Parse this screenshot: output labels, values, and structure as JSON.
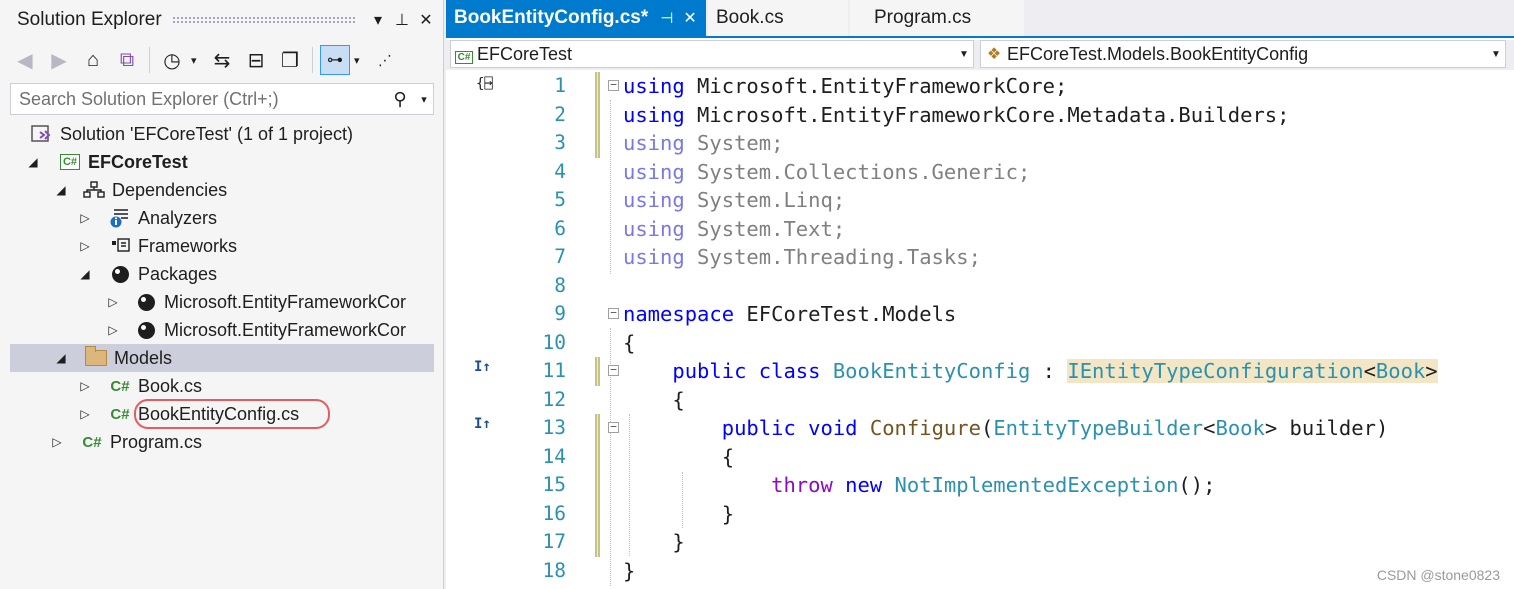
{
  "solution_explorer": {
    "title": "Solution Explorer",
    "search_placeholder": "Search Solution Explorer (Ctrl+;)",
    "tree": [
      {
        "label": "Solution 'EFCoreTest' (1 of 1 project)",
        "icon": "solution-icon"
      },
      {
        "label": "EFCoreTest",
        "icon": "csharp-project-icon",
        "expanded": true
      },
      {
        "label": "Dependencies",
        "icon": "dependencies-icon",
        "expanded": true
      },
      {
        "label": "Analyzers",
        "icon": "analyzers-icon",
        "expanded": false
      },
      {
        "label": "Frameworks",
        "icon": "frameworks-icon",
        "expanded": false
      },
      {
        "label": "Packages",
        "icon": "nuget-icon",
        "expanded": true
      },
      {
        "label": "Microsoft.EntityFrameworkCor",
        "icon": "nuget-icon",
        "expanded": false
      },
      {
        "label": "Microsoft.EntityFrameworkCor",
        "icon": "nuget-icon",
        "expanded": false
      },
      {
        "label": "Models",
        "icon": "folder-icon",
        "expanded": true,
        "selected": true
      },
      {
        "label": "Book.cs",
        "icon": "csharp-file-icon",
        "expanded": false
      },
      {
        "label": "BookEntityConfig.cs",
        "icon": "csharp-file-icon",
        "expanded": false,
        "highlighted": true
      },
      {
        "label": "Program.cs",
        "icon": "csharp-file-icon",
        "expanded": false
      }
    ]
  },
  "editor": {
    "tabs": [
      {
        "label": "BookEntityConfig.cs*",
        "active": true
      },
      {
        "label": "Book.cs",
        "active": false
      },
      {
        "label": "Program.cs",
        "active": false
      }
    ],
    "nav_project": "EFCoreTest",
    "nav_type": "EFCoreTest.Models.BookEntityConfig",
    "line_numbers": [
      "1",
      "2",
      "3",
      "4",
      "5",
      "6",
      "7",
      "8",
      "9",
      "10",
      "11",
      "12",
      "13",
      "14",
      "15",
      "16",
      "17",
      "18"
    ],
    "code": {
      "l1": [
        "using",
        " Microsoft.EntityFrameworkCore;"
      ],
      "l2": [
        "using",
        " Microsoft.EntityFrameworkCore.Metadata.Builders;"
      ],
      "l3": [
        "using",
        " System;"
      ],
      "l4": [
        "using",
        " System.Collections.Generic;"
      ],
      "l5": [
        "using",
        " System.Linq;"
      ],
      "l6": [
        "using",
        " System.Text;"
      ],
      "l7": [
        "using",
        " System.Threading.Tasks;"
      ],
      "l9": [
        "namespace",
        " EFCoreTest.Models"
      ],
      "l10": "{",
      "l11": [
        "public",
        " ",
        "class",
        " ",
        "BookEntityConfig",
        " : ",
        "IEntityTypeConfiguration",
        "<",
        "Book",
        ">"
      ],
      "l12": "{",
      "l13": [
        "public",
        " ",
        "void",
        " ",
        "Configure",
        "(",
        "EntityTypeBuilder",
        "<",
        "Book",
        ">",
        " builder)"
      ],
      "l14": "{",
      "l15": [
        "throw",
        " ",
        "new",
        " ",
        "NotImplementedException",
        "();"
      ],
      "l16": "}",
      "l17": "}",
      "l18": "}"
    },
    "glyph": "I↑",
    "watermark": "CSDN @stone0823"
  },
  "colors": {
    "accent": "#007ACC",
    "keyword": "#0000FF",
    "type": "#2B91AF",
    "control_keyword": "#8F08C4",
    "method": "#74531F",
    "annotation_ring": "#E25E5E"
  }
}
